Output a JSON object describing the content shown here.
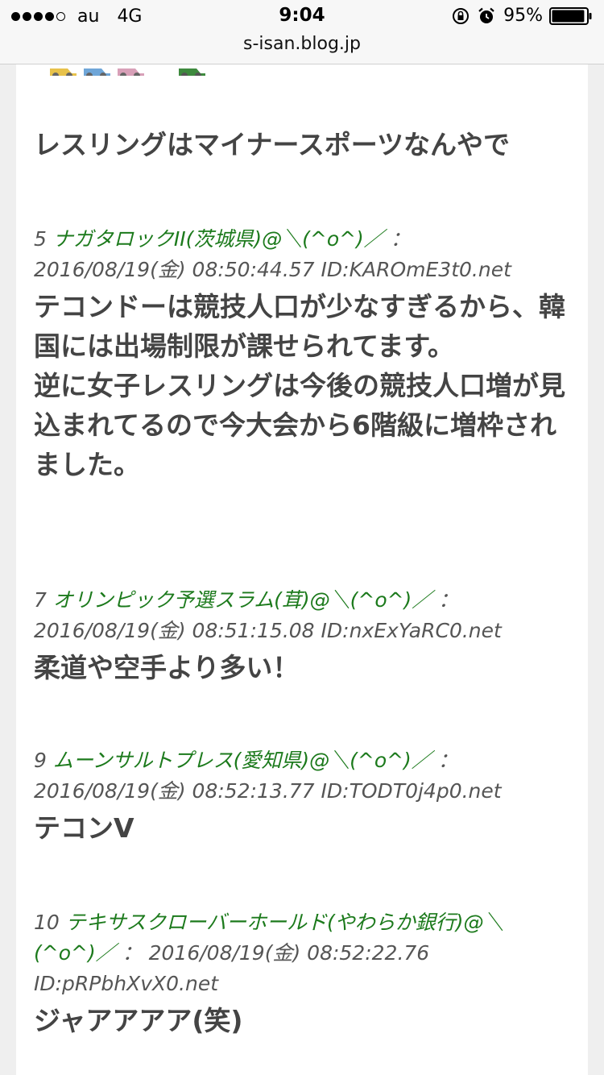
{
  "status_bar": {
    "carrier": "au",
    "network": "4G",
    "time": "9:04",
    "battery": "95%",
    "battery_level": 0.95
  },
  "url_bar": {
    "domain": "s-isan.blog.jp"
  },
  "article": {
    "headline": "レスリングはマイナースポーツなんやで",
    "posts": [
      {
        "number": "5",
        "name": "ナガタロックII(茨城県)@＼(^o^)／",
        "sep": "：",
        "datetime": "2016/08/19(金) 08:50:44.57",
        "id": "ID:KAROmE3t0.net",
        "body": "テコンドーは競技人口が少なすぎるから、韓国には出場制限が課せられてます。\n逆に女子レスリングは今後の競技人口増が見込まれてるので今大会から6階級に増枠されました。"
      },
      {
        "number": "7",
        "name": "オリンピック予選スラム(茸)@＼(^o^)／",
        "sep": "：",
        "datetime": "2016/08/19(金) 08:51:15.08",
        "id": "ID:nxExYaRC0.net",
        "body": "柔道や空手より多い！"
      },
      {
        "number": "9",
        "name": "ムーンサルトプレス(愛知県)@＼(^o^)／",
        "sep": "：",
        "datetime": "2016/08/19(金) 08:52:13.77",
        "id": "ID:TODT0j4p0.net",
        "body": "テコンV"
      },
      {
        "number": "10",
        "name": "テキサスクローバーホールド(やわらか銀行)@＼(^o^)／",
        "sep": "：",
        "datetime": "2016/08/19(金) 08:52:22.76",
        "id": "ID:pRPbhXvX0.net",
        "body": "ジャアアアア(笑)"
      }
    ]
  }
}
